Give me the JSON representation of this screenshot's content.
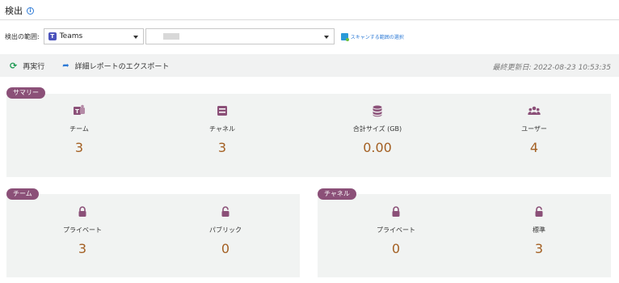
{
  "header": {
    "title": "検出"
  },
  "scope": {
    "label": "検出の範囲:",
    "service_value": "Teams",
    "scan_link": "スキャンする範囲の選択"
  },
  "toolbar": {
    "rerun_label": "再実行",
    "export_label": "詳細レポートのエクスポート",
    "last_updated": "最終更新日: 2022-08-23 10:53:35"
  },
  "summary": {
    "title": "サマリー",
    "items": [
      {
        "label": "チーム",
        "value": "3",
        "icon": "teams-icon"
      },
      {
        "label": "チャネル",
        "value": "3",
        "icon": "channel-icon"
      },
      {
        "label": "合計サイズ (GB)",
        "value": "0.00",
        "icon": "database-icon"
      },
      {
        "label": "ユーザー",
        "value": "4",
        "icon": "users-icon"
      }
    ]
  },
  "teams": {
    "title": "チーム",
    "items": [
      {
        "label": "プライベート",
        "value": "3",
        "icon": "lock-closed-icon"
      },
      {
        "label": "パブリック",
        "value": "0",
        "icon": "lock-open-icon"
      }
    ]
  },
  "channels": {
    "title": "チャネル",
    "items": [
      {
        "label": "プライベート",
        "value": "0",
        "icon": "lock-closed-icon"
      },
      {
        "label": "標準",
        "value": "3",
        "icon": "lock-open-icon"
      }
    ]
  },
  "colors": {
    "accent_pill": "#8b5078",
    "value_text": "#a35f22",
    "panel_bg": "#f1f3f2",
    "link": "#2e7bd6"
  }
}
